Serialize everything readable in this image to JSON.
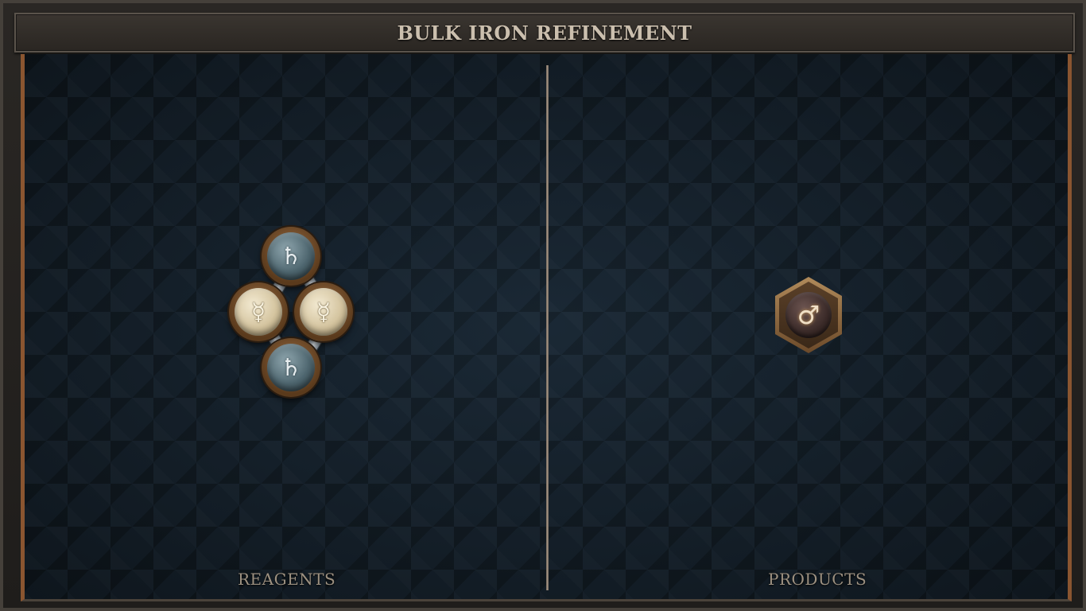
{
  "title": "BULK IRON REFINEMENT",
  "sections": {
    "reagents_label": "REAGENTS",
    "products_label": "PRODUCTS"
  },
  "reagents": {
    "atoms": [
      {
        "element": "lead",
        "symbol": "♄"
      },
      {
        "element": "quicksilver",
        "symbol": "☿"
      },
      {
        "element": "quicksilver",
        "symbol": "☿"
      },
      {
        "element": "lead",
        "symbol": "♄"
      }
    ]
  },
  "products": {
    "atoms": [
      {
        "element": "iron",
        "symbol": "♂"
      }
    ]
  },
  "colors": {
    "board": "#16222d",
    "accent_copper": "#8a5530",
    "title_text": "#cbbfae",
    "label_text": "#9d9181"
  }
}
